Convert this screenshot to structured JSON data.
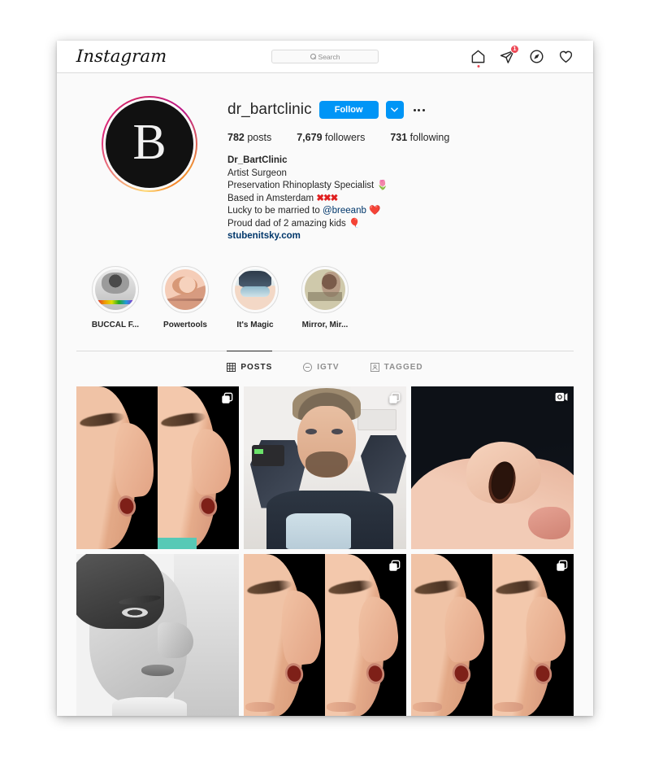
{
  "navbar": {
    "brand": "Instagram",
    "search": {
      "placeholder": "Search",
      "icon": "search-icon"
    },
    "icons": [
      {
        "name": "home-icon",
        "has_dot": true
      },
      {
        "name": "direct-send-icon",
        "badge": "1"
      },
      {
        "name": "explore-compass-icon"
      },
      {
        "name": "activity-heart-icon"
      }
    ]
  },
  "profile": {
    "avatar": {
      "letter": "B",
      "has_story_ring": true
    },
    "username": "dr_bartclinic",
    "follow_label": "Follow",
    "chevron_icon": "chevron-down-icon",
    "more_icon": "more-options-icon",
    "stats": [
      {
        "value": "782",
        "label": "posts"
      },
      {
        "value": "7,679",
        "label": "followers"
      },
      {
        "value": "731",
        "label": "following"
      }
    ],
    "bio": {
      "full_name": "Dr_BartClinic",
      "lines": [
        "Artist Surgeon",
        "Preservation Rhinoplasty Specialist 🌷",
        "Based in Amsterdam",
        "Lucky to be married to",
        "Proud dad of 2 amazing kids 🎈"
      ],
      "amsterdam_marks": "✖✖✖",
      "mention": "@breeanb",
      "heart": "❤️",
      "website": "stubenitsky.com"
    }
  },
  "highlights": [
    {
      "label": "BUCCAL F...",
      "art": "hl1"
    },
    {
      "label": "Powertools",
      "art": "hl2"
    },
    {
      "label": "It's Magic",
      "art": "hl3"
    },
    {
      "label": "Mirror, Mir...",
      "art": "hl4"
    }
  ],
  "tabs": [
    {
      "label": "POSTS",
      "icon": "grid-icon",
      "active": true
    },
    {
      "label": "IGTV",
      "icon": "igtv-icon",
      "active": false
    },
    {
      "label": "TAGGED",
      "icon": "tagged-icon",
      "active": false
    }
  ],
  "posts": [
    {
      "art": "split-nose-a",
      "badge": "carousel-icon",
      "alt": "before and after nose profile"
    },
    {
      "art": "selfie",
      "badge": "carousel-icon",
      "alt": "surgeon selfie with mask"
    },
    {
      "art": "closeup",
      "badge": "video-icon",
      "alt": "nostril close up"
    },
    {
      "art": "bw-portrait",
      "badge": null,
      "alt": "black and white portrait"
    },
    {
      "art": "split-nose-b",
      "badge": "carousel-icon",
      "alt": "before and after nose profile"
    },
    {
      "art": "split-nose-c",
      "badge": "carousel-icon",
      "alt": "before and after nose profile"
    }
  ],
  "colors": {
    "brand_blue": "#0095f6",
    "badge_red": "#ed4956",
    "text_primary": "#262626",
    "text_secondary": "#8e8e8e",
    "link_blue": "#00376b",
    "border": "#dbdbdb",
    "page_bg": "#fafafa"
  }
}
